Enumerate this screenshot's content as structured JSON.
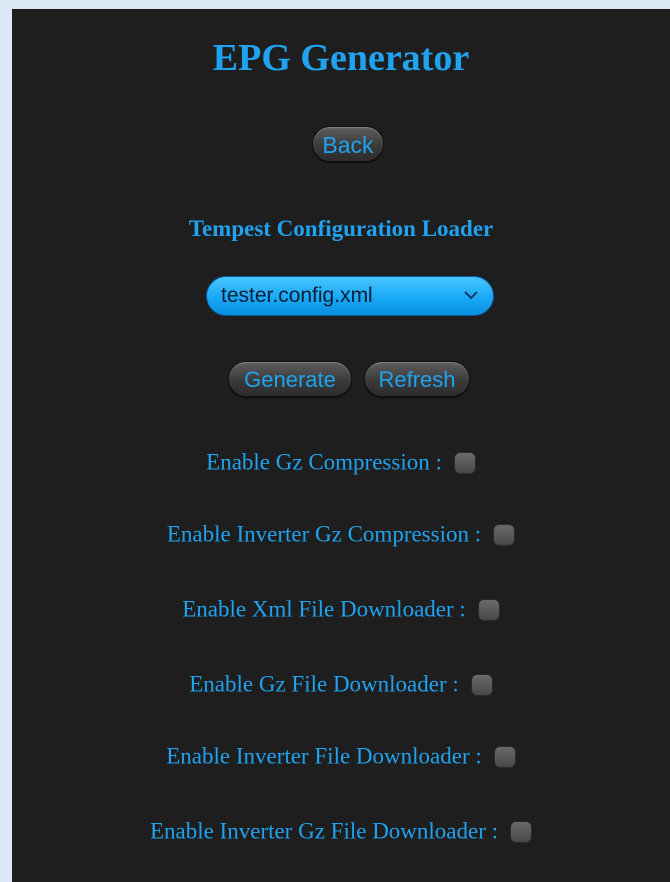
{
  "header": {
    "title": "EPG Generator",
    "back_label": "Back"
  },
  "loader": {
    "title": "Tempest Configuration Loader",
    "selected_config": "tester.config.xml",
    "generate_label": "Generate",
    "refresh_label": "Refresh"
  },
  "options": [
    {
      "label": "Enable Gz Compression :",
      "checked": false
    },
    {
      "label": "Enable Inverter Gz Compression :",
      "checked": false
    },
    {
      "label": "Enable Xml File Downloader :",
      "checked": false
    },
    {
      "label": "Enable Gz File Downloader :",
      "checked": false
    },
    {
      "label": "Enable Inverter File Downloader :",
      "checked": false
    },
    {
      "label": "Enable Inverter Gz File Downloader :",
      "checked": false
    }
  ],
  "icons": {
    "select_arrow": "chevron-down-icon"
  },
  "colors": {
    "accent": "#1fa3f0",
    "panel_background": "#1e1e1e",
    "page_background": "#dde8f7",
    "select_fill": "#17a9f7"
  }
}
